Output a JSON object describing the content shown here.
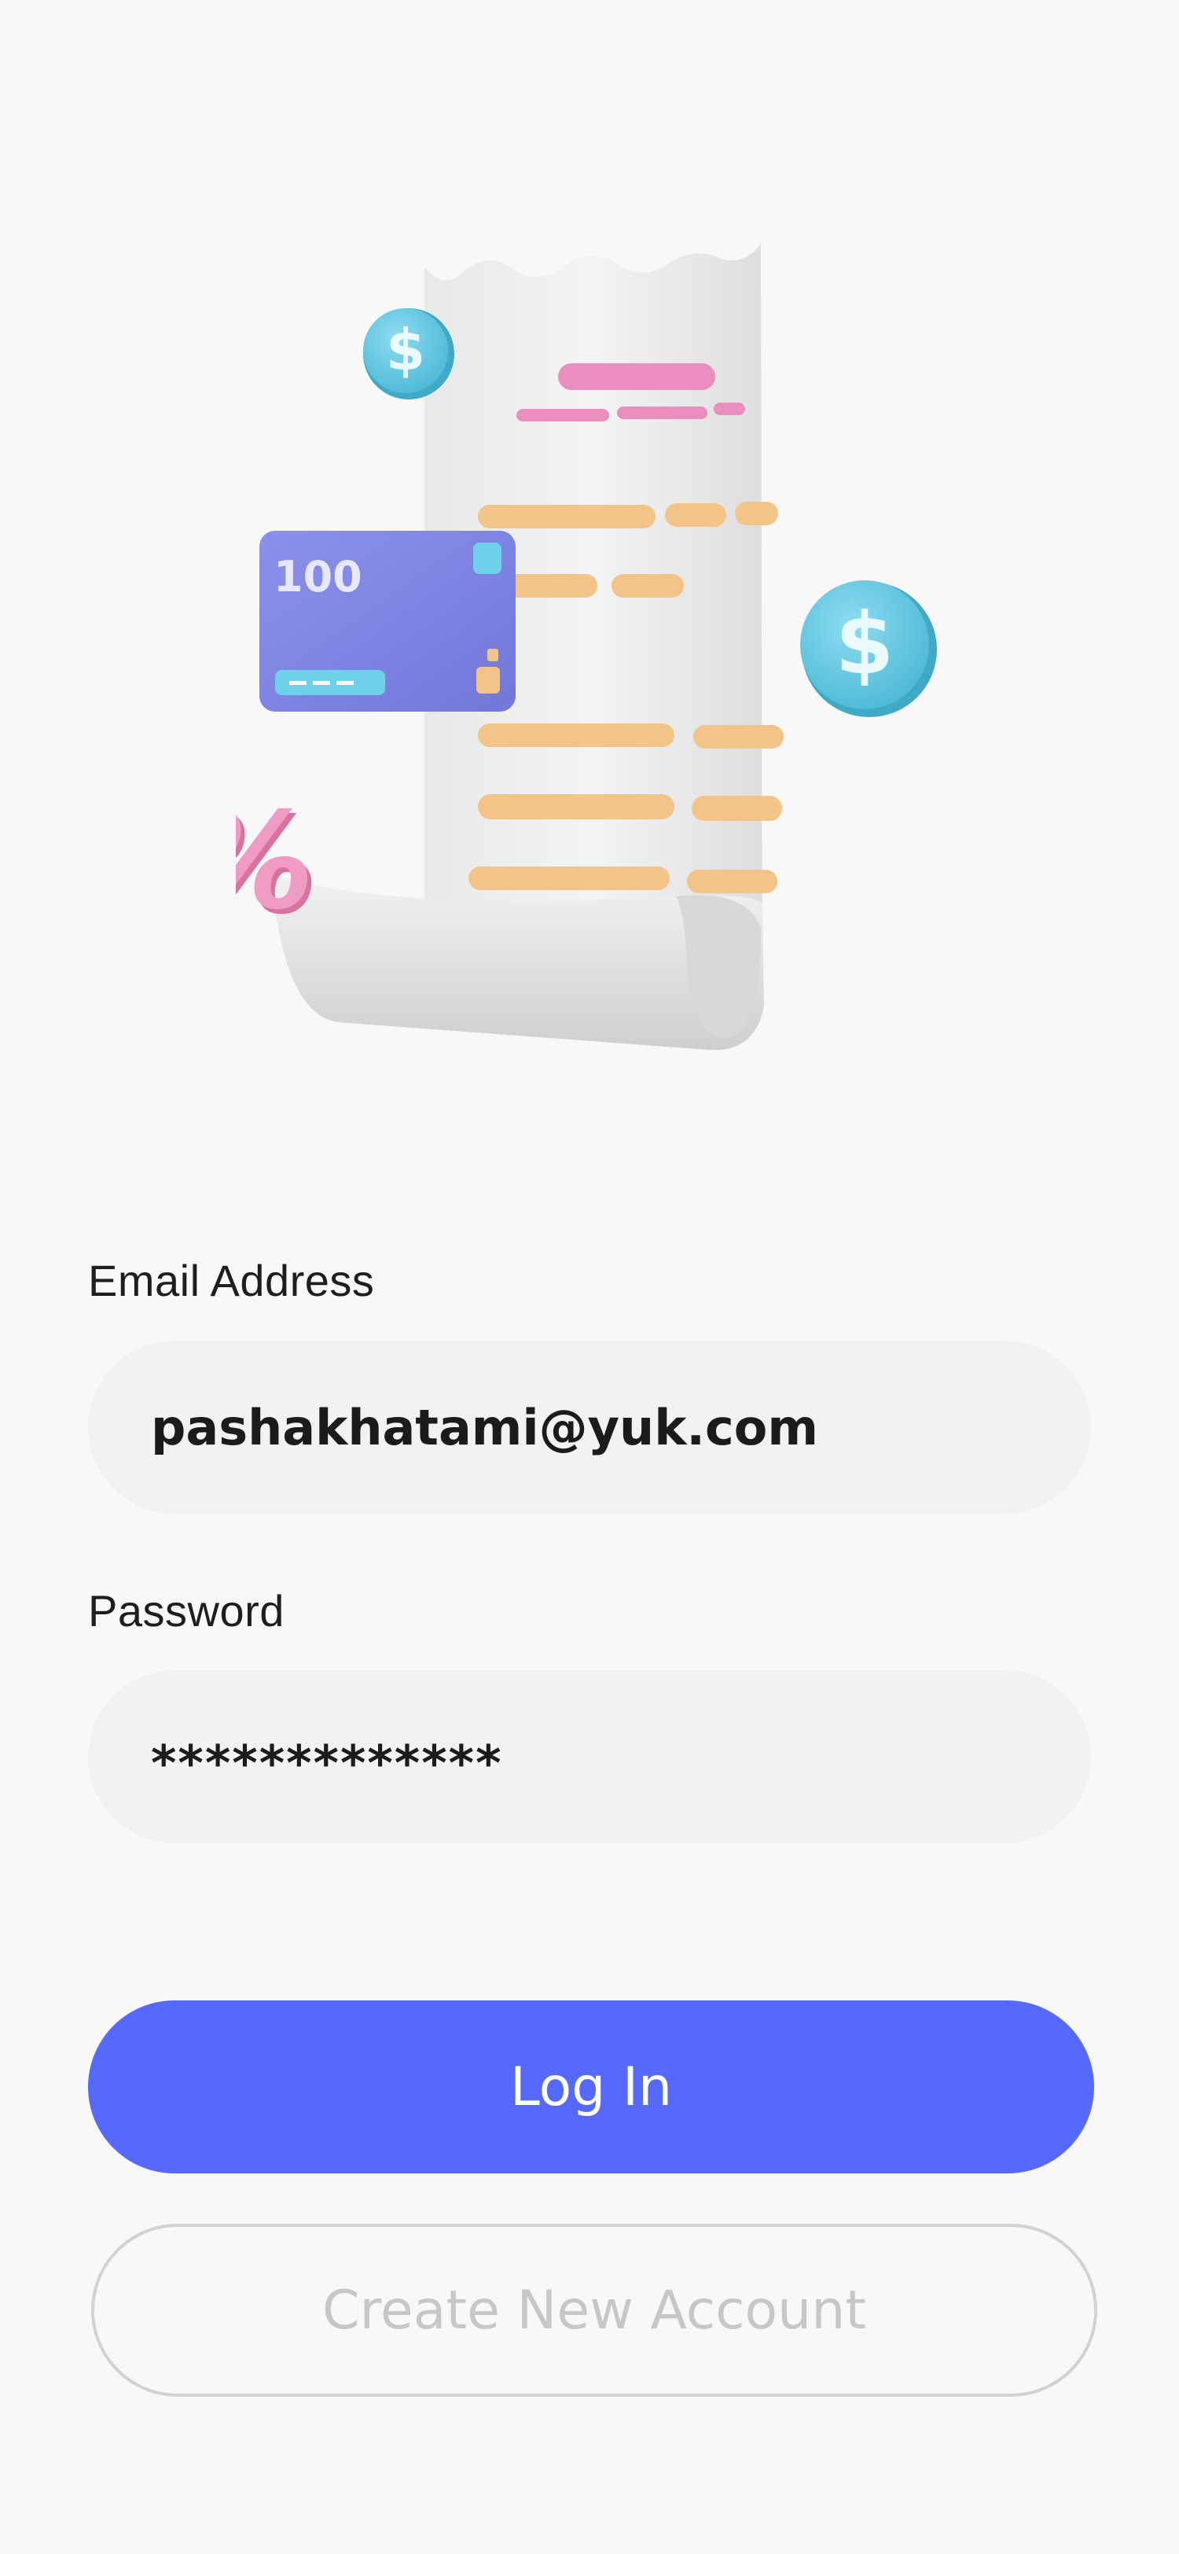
{
  "form": {
    "email_label": "Email Address",
    "email_value": "pashakhatami@yuk.com",
    "password_label": "Password",
    "password_value": "*************"
  },
  "buttons": {
    "login_label": "Log In",
    "create_account_label": "Create New Account"
  },
  "illustration": {
    "card_amount": "100",
    "coin_symbol": "$",
    "percent_symbol": "%"
  },
  "colors": {
    "primary": "#5669fd",
    "background": "#f8f8f8",
    "field_bg": "#f2f2f2",
    "coin": "#67cce3",
    "card": "#7f86e6",
    "receipt_lines_orange": "#f2c487",
    "receipt_lines_pink": "#ea8fbd"
  }
}
